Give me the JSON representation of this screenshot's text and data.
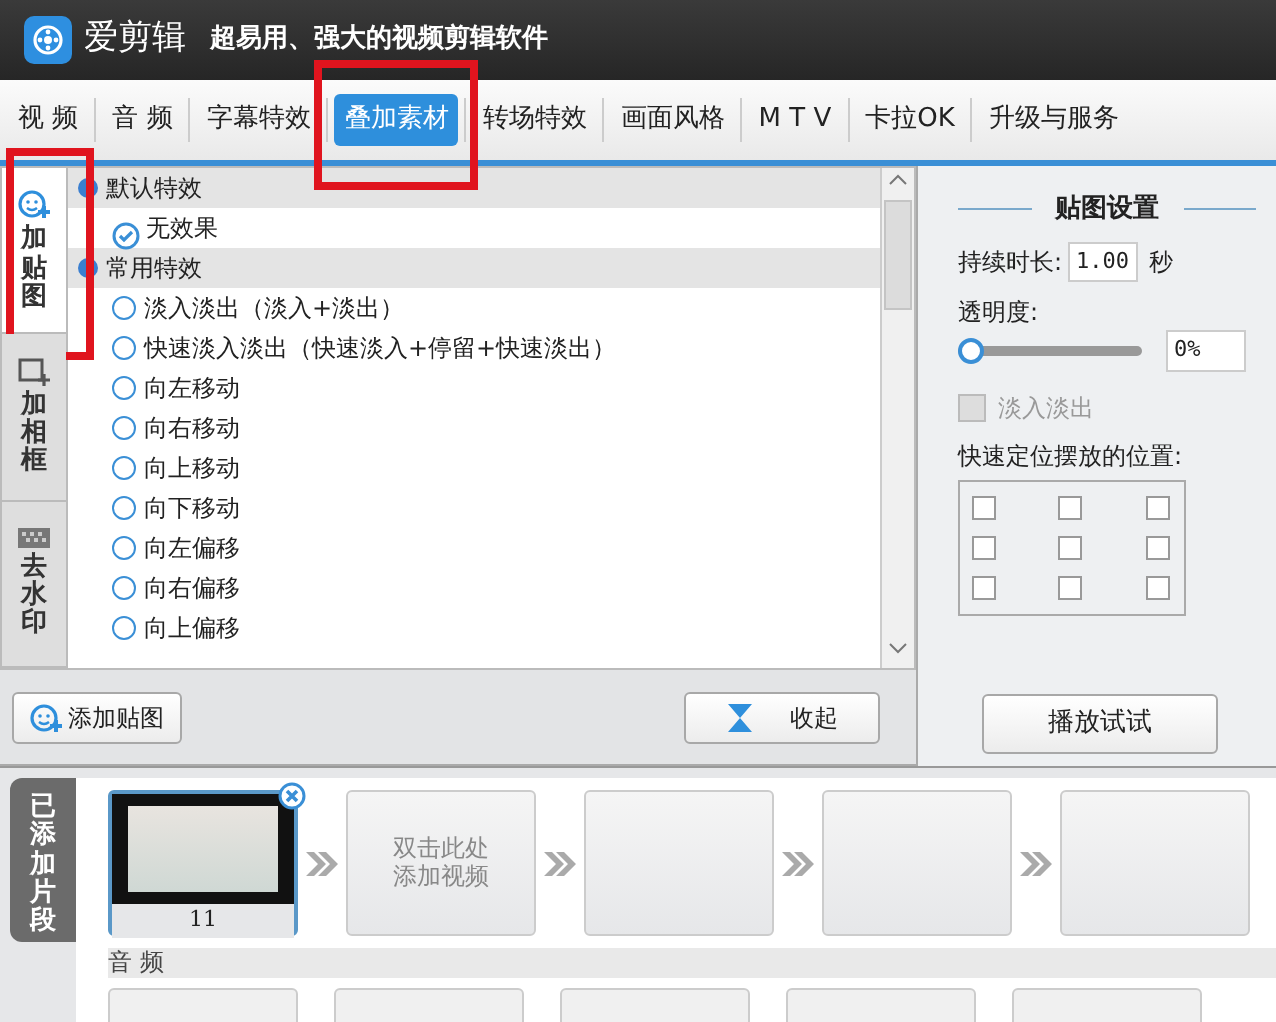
{
  "app": {
    "name": "爱剪辑",
    "slogan": "超易用、强大的视频剪辑软件"
  },
  "tabs": [
    {
      "label": "视  频",
      "selected": false,
      "highlighted": false
    },
    {
      "label": "音  频",
      "selected": false,
      "highlighted": false
    },
    {
      "label": "字幕特效",
      "selected": false,
      "highlighted": false
    },
    {
      "label": "叠加素材",
      "selected": true,
      "highlighted": true
    },
    {
      "label": "转场特效",
      "selected": false,
      "highlighted": false
    },
    {
      "label": "画面风格",
      "selected": false,
      "highlighted": false
    },
    {
      "label": "M T V",
      "selected": false,
      "highlighted": false
    },
    {
      "label": "卡拉OK",
      "selected": false,
      "highlighted": false
    },
    {
      "label": "升级与服务",
      "selected": false,
      "highlighted": false
    }
  ],
  "side_tabs": [
    {
      "label": "加贴图",
      "selected": true,
      "highlighted": true,
      "kind": "sticker"
    },
    {
      "label": "加相框",
      "selected": false,
      "highlighted": false,
      "kind": "frame"
    },
    {
      "label": "去水印",
      "selected": false,
      "highlighted": false,
      "kind": "watermark"
    }
  ],
  "effect_groups": [
    {
      "title": "默认特效",
      "children": [
        {
          "label": "无效果",
          "selected": true
        }
      ]
    },
    {
      "title": "常用特效",
      "children": [
        {
          "label": "淡入淡出（淡入+淡出）",
          "selected": false
        },
        {
          "label": "快速淡入淡出（快速淡入+停留+快速淡出）",
          "selected": false
        },
        {
          "label": "向左移动",
          "selected": false
        },
        {
          "label": "向右移动",
          "selected": false
        },
        {
          "label": "向上移动",
          "selected": false
        },
        {
          "label": "向下移动",
          "selected": false
        },
        {
          "label": "向左偏移",
          "selected": false
        },
        {
          "label": "向右偏移",
          "selected": false
        },
        {
          "label": "向上偏移",
          "selected": false
        }
      ]
    }
  ],
  "toolbar": {
    "add_button": "添加贴图",
    "collapse_button": "收起"
  },
  "settings": {
    "title": "贴图设置",
    "duration_label": "持续时长:",
    "duration_value": "1.00",
    "duration_unit": "秒",
    "opacity_label": "透明度:",
    "opacity": {
      "level": 0,
      "value": "0%"
    },
    "fade": {
      "label": "淡入淡出",
      "checked": false,
      "disabled": true
    },
    "position_label": "快速定位摆放的位置:",
    "positions": [
      {
        "checked": false
      },
      {
        "checked": false
      },
      {
        "checked": false
      },
      {
        "checked": false
      },
      {
        "checked": false
      },
      {
        "checked": false
      },
      {
        "checked": false
      },
      {
        "checked": false
      },
      {
        "checked": false
      }
    ],
    "preview_button": "播放试试"
  },
  "timeline": {
    "tab": "已添加片段",
    "clips": [
      {
        "kind": "video",
        "caption": "11",
        "selected": true
      },
      {
        "kind": "placeholder",
        "lines": [
          "双击此处",
          "添加视频"
        ]
      },
      {
        "kind": "empty"
      },
      {
        "kind": "empty"
      },
      {
        "kind": "empty"
      }
    ],
    "audio_label": "音 频"
  }
}
